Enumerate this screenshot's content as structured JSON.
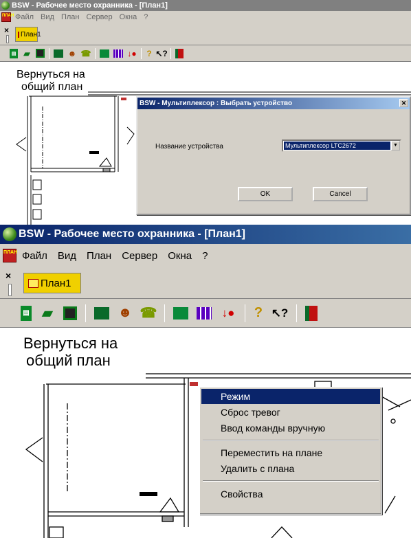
{
  "window": {
    "title": "BSW - Рабочее место охранника - [План1]",
    "menu": [
      "Файл",
      "Вид",
      "План",
      "Сервер",
      "Окна",
      "?"
    ],
    "tab_close": "×",
    "tab_label": "План1",
    "back_link": [
      "Вернуться на",
      "общий план"
    ]
  },
  "dialog": {
    "title": "BSW - Мультиплексор : Выбрать устройство",
    "close": "✕",
    "field_label": "Название устройства",
    "device_value": "Мультиплексор LTC2672",
    "ok_label": "OK",
    "cancel_label": "Cancel"
  },
  "context_menu": {
    "items": [
      "Режим",
      "Сброс тревог",
      "Ввод команды вручную",
      "Переместить на плане",
      "Удалить с плана",
      "Свойства"
    ],
    "selected": "Режим"
  },
  "colors": {
    "titlebar_active": "#0a246a",
    "titlebar_inactive": "#808080",
    "tab_bg": "#f0d000",
    "selection": "#0a246a",
    "face": "#d4d0c8"
  },
  "toolbar_icons": [
    "doc-green-icon",
    "folder-open-icon",
    "save-icon",
    "monitor-icon",
    "users-icon",
    "phone-icon",
    "windows-icon",
    "columns-icon",
    "alarm-icon",
    "help-icon",
    "whats-this-icon",
    "exit-door-icon"
  ]
}
